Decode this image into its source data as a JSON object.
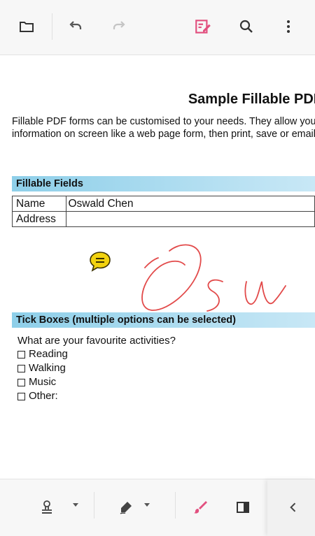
{
  "toolbar": {
    "icons": [
      "folder-icon",
      "undo-icon",
      "redo-icon",
      "annotate-icon",
      "search-icon",
      "more-vert-icon"
    ],
    "accent_color": "#e2507f"
  },
  "document": {
    "title": "Sample Fillable PDF",
    "intro_line1": "Fillable PDF forms can be customised to your needs. They allow you to enter",
    "intro_line2": "information on screen like a web page form, then print, save or email the",
    "fields_section": "Fillable Fields",
    "fields": [
      {
        "label": "Name",
        "value": "Oswald Chen"
      },
      {
        "label": "Address",
        "value": ""
      }
    ],
    "tick_section": "Tick Boxes (multiple options can be selected)",
    "question": "What are your favourite activities?",
    "options": [
      "Reading",
      "Walking",
      "Music",
      "Other:"
    ],
    "signature_color": "#e24a4a",
    "comment_color": "#f2d20f"
  },
  "bottom_toolbar": {
    "icons": [
      "stamp-icon",
      "pen-icon",
      "brush-icon",
      "panel-icon",
      "chevron-left-icon"
    ]
  }
}
